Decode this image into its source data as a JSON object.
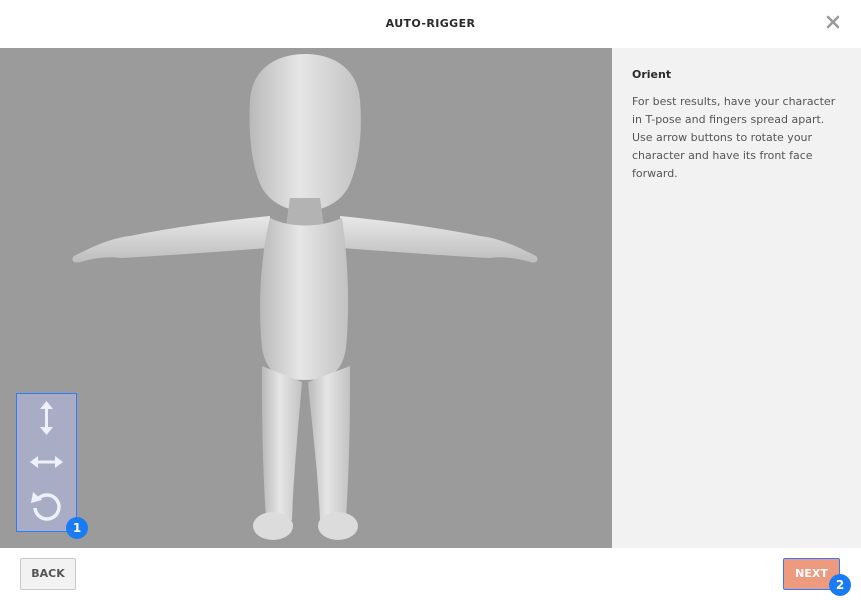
{
  "header": {
    "title": "AUTO-RIGGER",
    "close_icon": "close-icon"
  },
  "viewport": {
    "background": "#9b9b9b",
    "model": "t-pose character model",
    "controls": {
      "items": [
        {
          "icon": "vertical-arrows-icon"
        },
        {
          "icon": "horizontal-arrows-icon"
        },
        {
          "icon": "rotate-icon"
        }
      ],
      "badge": "1"
    }
  },
  "side_panel": {
    "heading": "Orient",
    "body": "For best results, have your character in T-pose and fingers spread apart. Use arrow buttons to rotate your character and have its front face forward."
  },
  "footer": {
    "back_label": "BACK",
    "next_label": "NEXT",
    "next_badge": "2",
    "accent": "#ee9a7f",
    "highlight": "#2f7bff"
  }
}
